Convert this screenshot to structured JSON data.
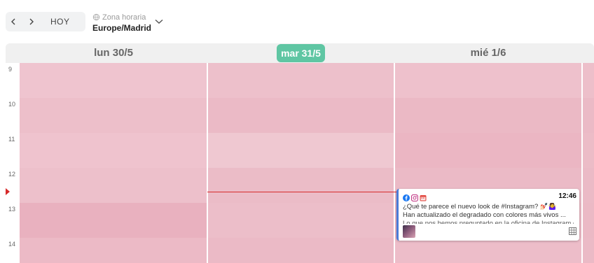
{
  "toolbar": {
    "prev_icon": "chevron-left-icon",
    "next_icon": "chevron-right-icon",
    "today_label": "HOY",
    "timezone_label": "Zona horaria",
    "timezone_value": "Europe/Madrid",
    "timezone_icon": "globe-icon",
    "dropdown_icon": "chevron-down-icon"
  },
  "days": [
    {
      "label": "lun 30/5",
      "is_today": false
    },
    {
      "label": "mar 31/5",
      "is_today": true
    },
    {
      "label": "mié 1/6",
      "is_today": false
    }
  ],
  "hours": [
    "9",
    "10",
    "11",
    "12",
    "13",
    "14"
  ],
  "post": {
    "networks": [
      "facebook-icon",
      "instagram-icon",
      "calendar-icon"
    ],
    "time": "12:46",
    "line1": "¿Qué te parece el nuevo look de #Instagram? 💅🏻🤷‍♀️",
    "line2": "Han actualizado el degradado con colores más vivos ...",
    "line3": "Lo que nos hemos preguntado en la oficina de Instagram es ¿y el logo?",
    "thumbnail": "post-thumbnail-image",
    "grid_icon": "grid-icon"
  },
  "colors": {
    "accent_today": "#5fc6a3",
    "now_indicator": "#d62a2a",
    "slot_pink": "#ecbcc7",
    "post_border": "#4a7bd8"
  }
}
